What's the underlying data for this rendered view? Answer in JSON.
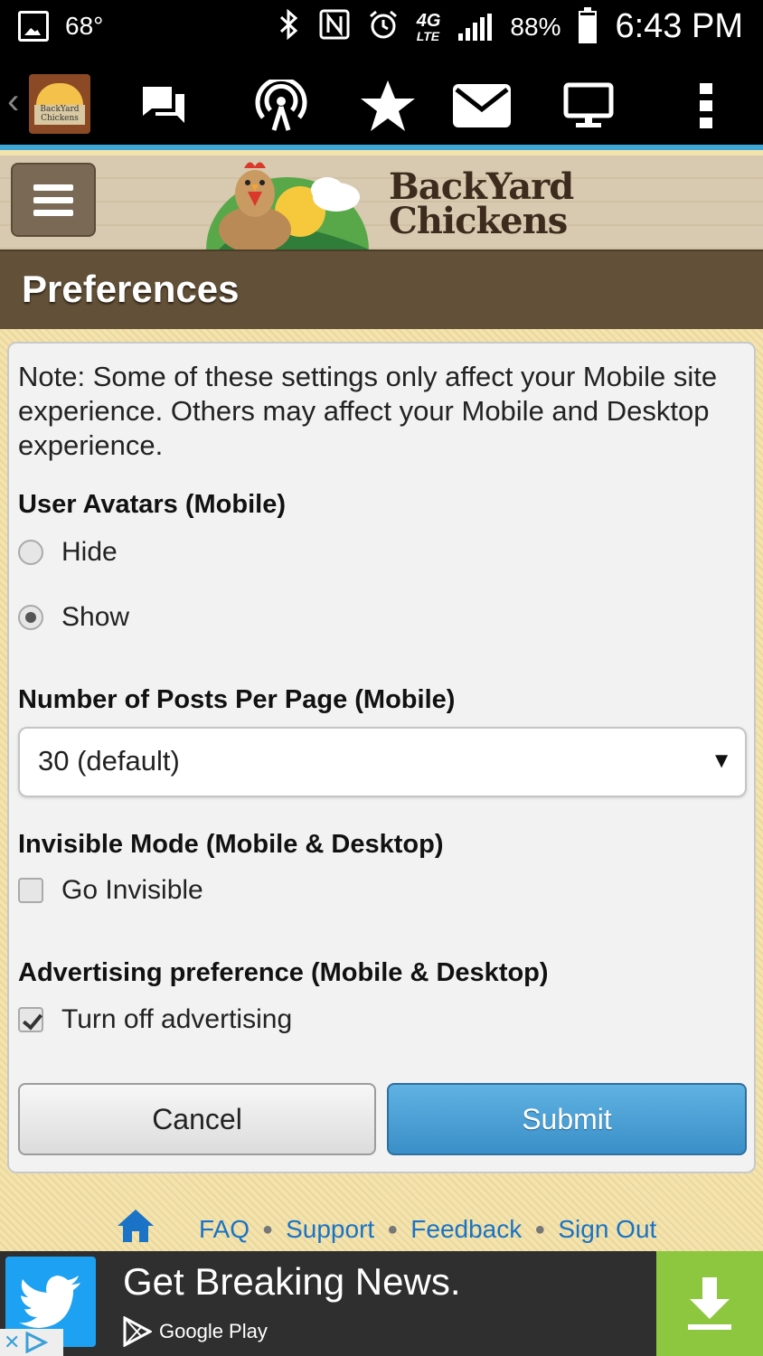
{
  "status_bar": {
    "temperature": "68°",
    "network": "4G",
    "network_sub": "LTE",
    "battery": "88%",
    "battery_level": 0.88,
    "time": "6:43 PM"
  },
  "app_toolbar": {
    "logo_text": "BackYard Chickens",
    "icons": [
      "forum-icon",
      "podcast-icon",
      "star-icon",
      "mail-icon",
      "desktop-icon",
      "overflow-menu-icon"
    ]
  },
  "header": {
    "brand_line1": "BackYard",
    "brand_line2": "Chickens"
  },
  "page": {
    "title": "Preferences"
  },
  "form": {
    "note": "Note: Some of these settings only affect your Mobile site experience. Others may affect your Mobile and Desktop experience.",
    "avatars": {
      "label": "User Avatars (Mobile)",
      "options": [
        "Hide",
        "Show"
      ],
      "selected": "Show"
    },
    "posts_per_page": {
      "label": "Number of Posts Per Page (Mobile)",
      "selected": "30 (default)"
    },
    "invisible": {
      "label": "Invisible Mode (Mobile & Desktop)",
      "option": "Go Invisible",
      "checked": false
    },
    "advertising": {
      "label": "Advertising preference (Mobile & Desktop)",
      "option": "Turn off advertising",
      "checked": true
    },
    "cancel_label": "Cancel",
    "submit_label": "Submit"
  },
  "footer": {
    "links": [
      "FAQ",
      "Support",
      "Feedback",
      "Sign Out"
    ]
  },
  "ad": {
    "headline": "Get Breaking News.",
    "store": "Google Play"
  },
  "colors": {
    "accent_blue": "#3fa7d6",
    "title_bar": "#625138",
    "submit": "#4aa0d6",
    "link": "#1a73c6",
    "ad_download": "#8dc63f"
  }
}
